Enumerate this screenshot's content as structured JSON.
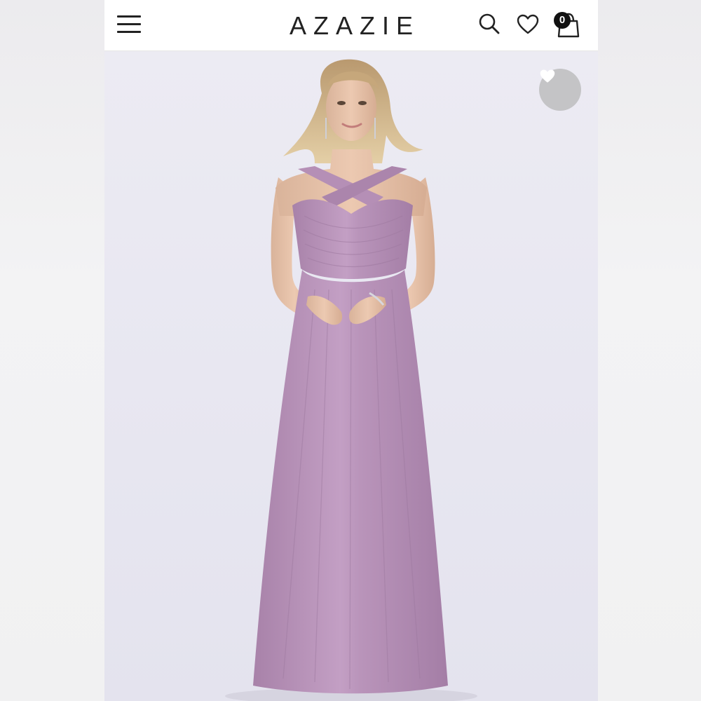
{
  "header": {
    "brand": "AZAZIE",
    "bag_count": "0"
  },
  "icons": {
    "menu": "menu-icon",
    "search": "search-icon",
    "wishlist": "heart-icon",
    "bag": "shopping-bag-icon",
    "image_wishlist": "heart-filled-icon"
  },
  "colors": {
    "dress": "#b894b8",
    "background": "#e8e7f1",
    "wishlist_button": "#c4c4c6"
  }
}
